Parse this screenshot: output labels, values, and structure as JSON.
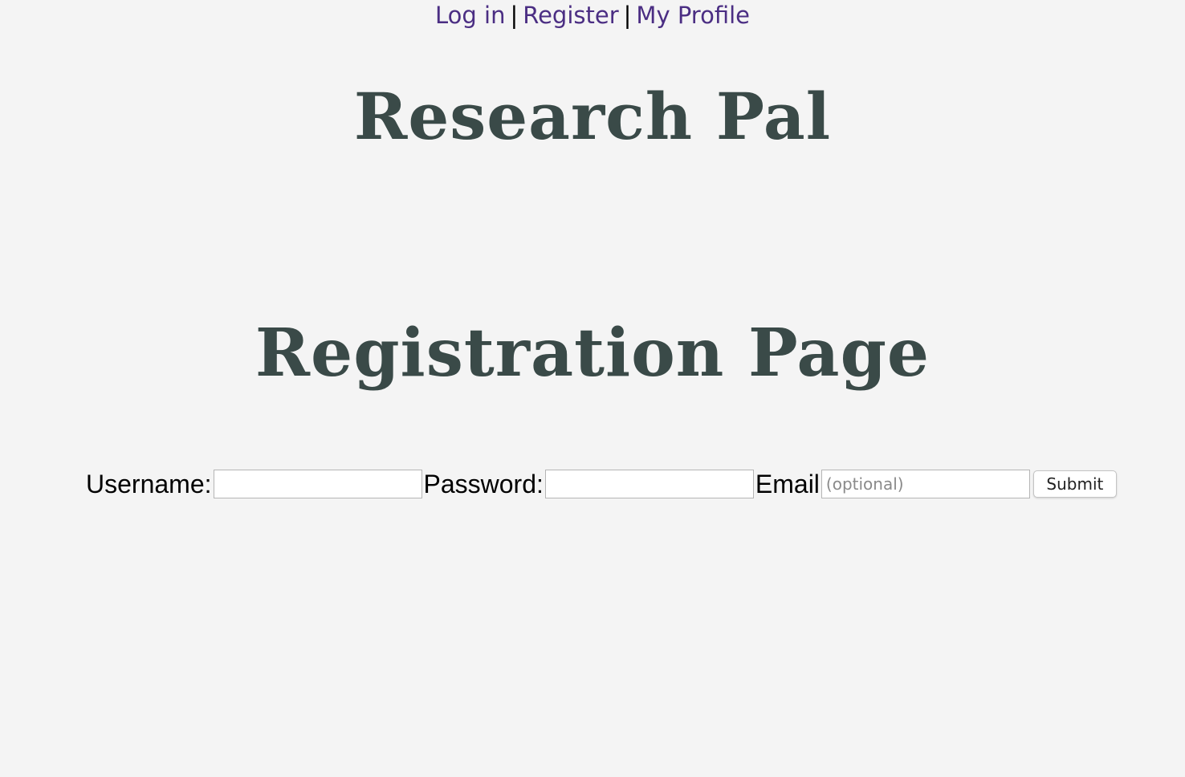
{
  "nav": {
    "links": [
      "Log in",
      "Register",
      "My Profile"
    ],
    "separator": "|"
  },
  "site_title": "Research Pal",
  "page_heading": "Registration Page",
  "form": {
    "username_label": "Username:",
    "password_label": "Password:",
    "email_label": "Email",
    "email_placeholder": "(optional)",
    "submit_label": "Submit"
  },
  "colors": {
    "link": "#4b2e83",
    "heading": "#3a4a48",
    "background": "#f4f4f4"
  }
}
